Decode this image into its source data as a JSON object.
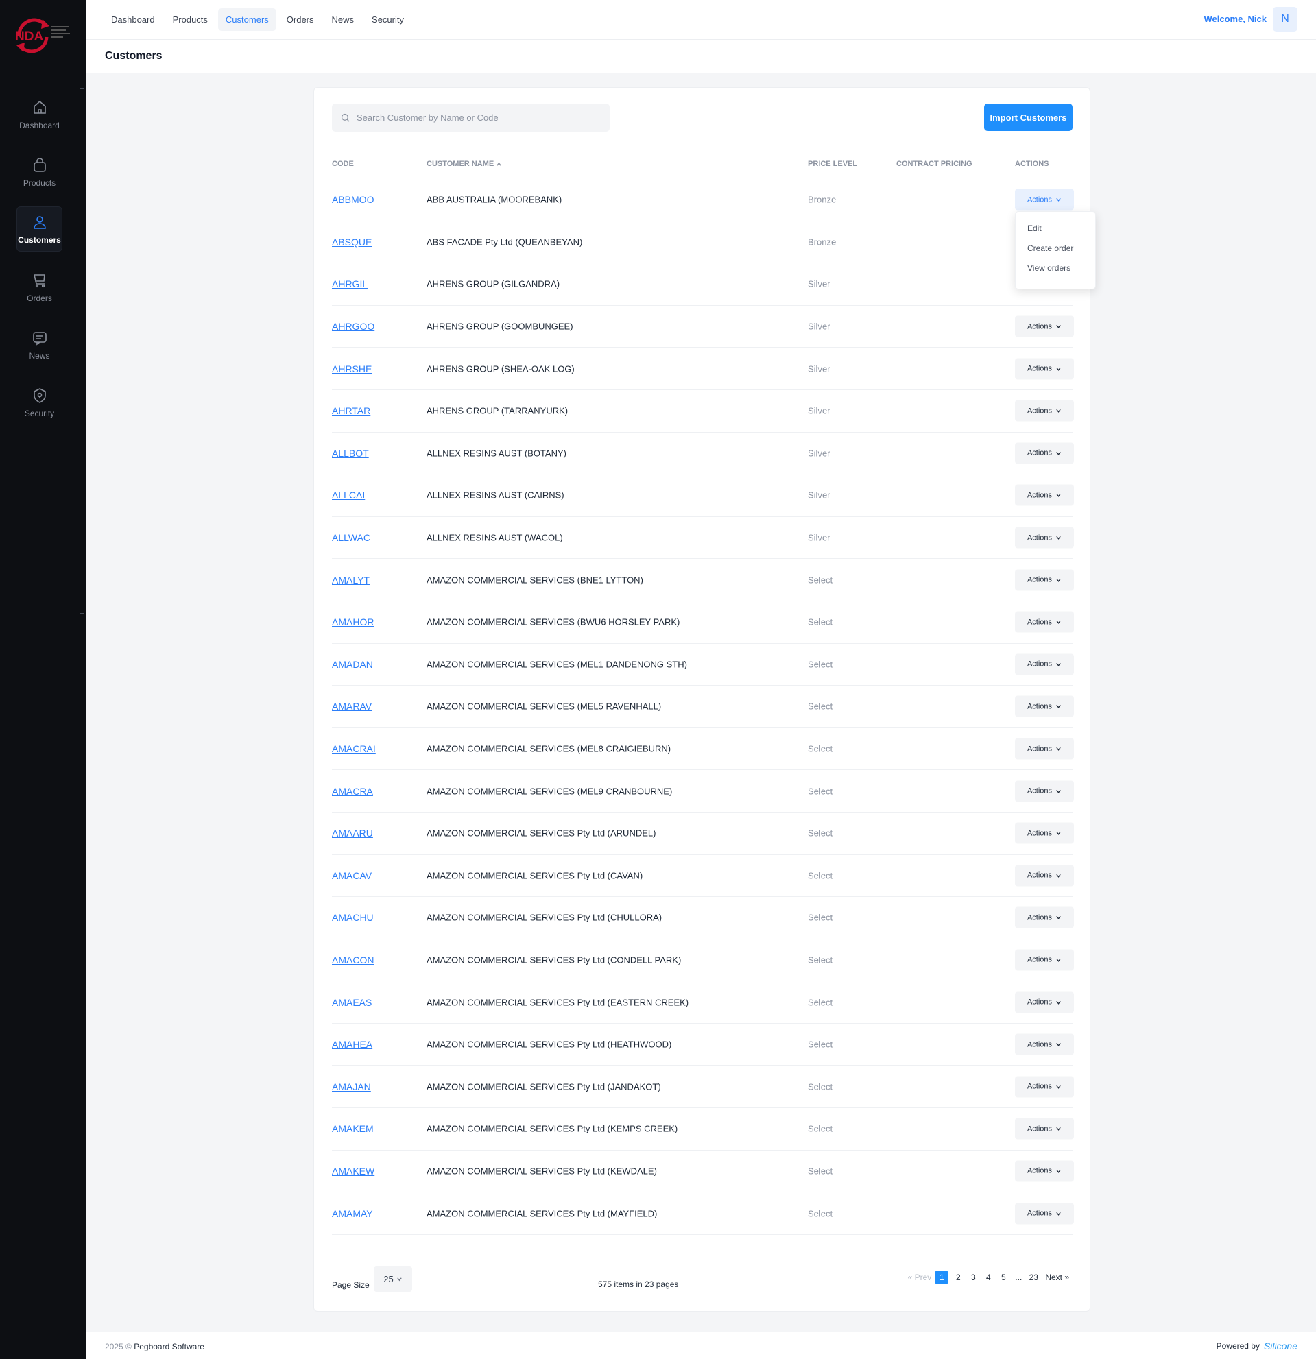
{
  "brand": {
    "name": "NDA"
  },
  "sidebar": {
    "items": [
      {
        "label": "Dashboard",
        "icon": "home-icon"
      },
      {
        "label": "Products",
        "icon": "bag-icon"
      },
      {
        "label": "Customers",
        "icon": "user-icon",
        "active": true
      },
      {
        "label": "Orders",
        "icon": "cart-icon"
      },
      {
        "label": "News",
        "icon": "message-icon"
      },
      {
        "label": "Security",
        "icon": "shield-icon"
      }
    ]
  },
  "topnav": {
    "tabs": [
      {
        "label": "Dashboard"
      },
      {
        "label": "Products"
      },
      {
        "label": "Customers",
        "active": true
      },
      {
        "label": "Orders"
      },
      {
        "label": "News"
      },
      {
        "label": "Security"
      }
    ],
    "welcome": "Welcome, Nick",
    "avatar": "N"
  },
  "page": {
    "title": "Customers"
  },
  "search": {
    "placeholder": "Search Customer by Name or Code"
  },
  "import_button": "Import Customers",
  "table": {
    "headers": {
      "code": "CODE",
      "name": "CUSTOMER NAME",
      "price": "PRICE LEVEL",
      "contract": "CONTRACT PRICING",
      "actions": "ACTIONS"
    },
    "action_label": "Actions",
    "rows": [
      {
        "code": "ABBMOO",
        "name": "ABB AUSTRALIA (MOOREBANK)",
        "price": "Bronze"
      },
      {
        "code": "ABSQUE",
        "name": "ABS FACADE Pty Ltd (QUEANBEYAN)",
        "price": "Bronze"
      },
      {
        "code": "AHRGIL",
        "name": "AHRENS GROUP (GILGANDRA)",
        "price": "Silver"
      },
      {
        "code": "AHRGOO",
        "name": "AHRENS GROUP (GOOMBUNGEE)",
        "price": "Silver"
      },
      {
        "code": "AHRSHE",
        "name": "AHRENS GROUP (SHEA-OAK LOG)",
        "price": "Silver"
      },
      {
        "code": "AHRTAR",
        "name": "AHRENS GROUP (TARRANYURK)",
        "price": "Silver"
      },
      {
        "code": "ALLBOT",
        "name": "ALLNEX RESINS AUST (BOTANY)",
        "price": "Silver"
      },
      {
        "code": "ALLCAI",
        "name": "ALLNEX RESINS AUST (CAIRNS)",
        "price": "Silver"
      },
      {
        "code": "ALLWAC",
        "name": "ALLNEX RESINS AUST (WACOL)",
        "price": "Silver"
      },
      {
        "code": "AMALYT",
        "name": "AMAZON COMMERCIAL SERVICES (BNE1 LYTTON)",
        "price": "Select"
      },
      {
        "code": "AMAHOR",
        "name": "AMAZON COMMERCIAL SERVICES (BWU6 HORSLEY PARK)",
        "price": "Select"
      },
      {
        "code": "AMADAN",
        "name": "AMAZON COMMERCIAL SERVICES (MEL1 DANDENONG STH)",
        "price": "Select"
      },
      {
        "code": "AMARAV",
        "name": "AMAZON COMMERCIAL SERVICES (MEL5 RAVENHALL)",
        "price": "Select"
      },
      {
        "code": "AMACRAI",
        "name": "AMAZON COMMERCIAL SERVICES (MEL8 CRAIGIEBURN)",
        "price": "Select"
      },
      {
        "code": "AMACRA",
        "name": "AMAZON COMMERCIAL SERVICES (MEL9 CRANBOURNE)",
        "price": "Select"
      },
      {
        "code": "AMAARU",
        "name": "AMAZON COMMERCIAL SERVICES Pty Ltd (ARUNDEL)",
        "price": "Select"
      },
      {
        "code": "AMACAV",
        "name": "AMAZON COMMERCIAL SERVICES Pty Ltd (CAVAN)",
        "price": "Select"
      },
      {
        "code": "AMACHU",
        "name": "AMAZON COMMERCIAL SERVICES Pty Ltd (CHULLORA)",
        "price": "Select"
      },
      {
        "code": "AMACON",
        "name": "AMAZON COMMERCIAL SERVICES Pty Ltd (CONDELL PARK)",
        "price": "Select"
      },
      {
        "code": "AMAEAS",
        "name": "AMAZON COMMERCIAL SERVICES Pty Ltd (EASTERN CREEK)",
        "price": "Select"
      },
      {
        "code": "AMAHEA",
        "name": "AMAZON COMMERCIAL SERVICES Pty Ltd (HEATHWOOD)",
        "price": "Select"
      },
      {
        "code": "AMAJAN",
        "name": "AMAZON COMMERCIAL SERVICES Pty Ltd (JANDAKOT)",
        "price": "Select"
      },
      {
        "code": "AMAKEM",
        "name": "AMAZON COMMERCIAL SERVICES Pty Ltd (KEMPS CREEK)",
        "price": "Select"
      },
      {
        "code": "AMAKEW",
        "name": "AMAZON COMMERCIAL SERVICES Pty Ltd (KEWDALE)",
        "price": "Select"
      },
      {
        "code": "AMAMAY",
        "name": "AMAZON COMMERCIAL SERVICES Pty Ltd (MAYFIELD)",
        "price": "Select"
      }
    ]
  },
  "dropdown": {
    "items": [
      "Edit",
      "Create order",
      "View orders"
    ]
  },
  "pagination": {
    "page_size_label": "Page Size",
    "page_size": "25",
    "info": "575 items in 23 pages",
    "prev": "« Prev",
    "pages": [
      "1",
      "2",
      "3",
      "4",
      "5",
      "...",
      "23"
    ],
    "current": "1",
    "next": "Next »"
  },
  "footer": {
    "copyright_prefix": "2025 ©",
    "company": "Pegboard Software",
    "powered": "Powered by",
    "powered_brand": "Silicone"
  },
  "colors": {
    "accent": "#1f8ffc",
    "sidebar": "#0d0f13",
    "link": "#2d7ff9"
  }
}
